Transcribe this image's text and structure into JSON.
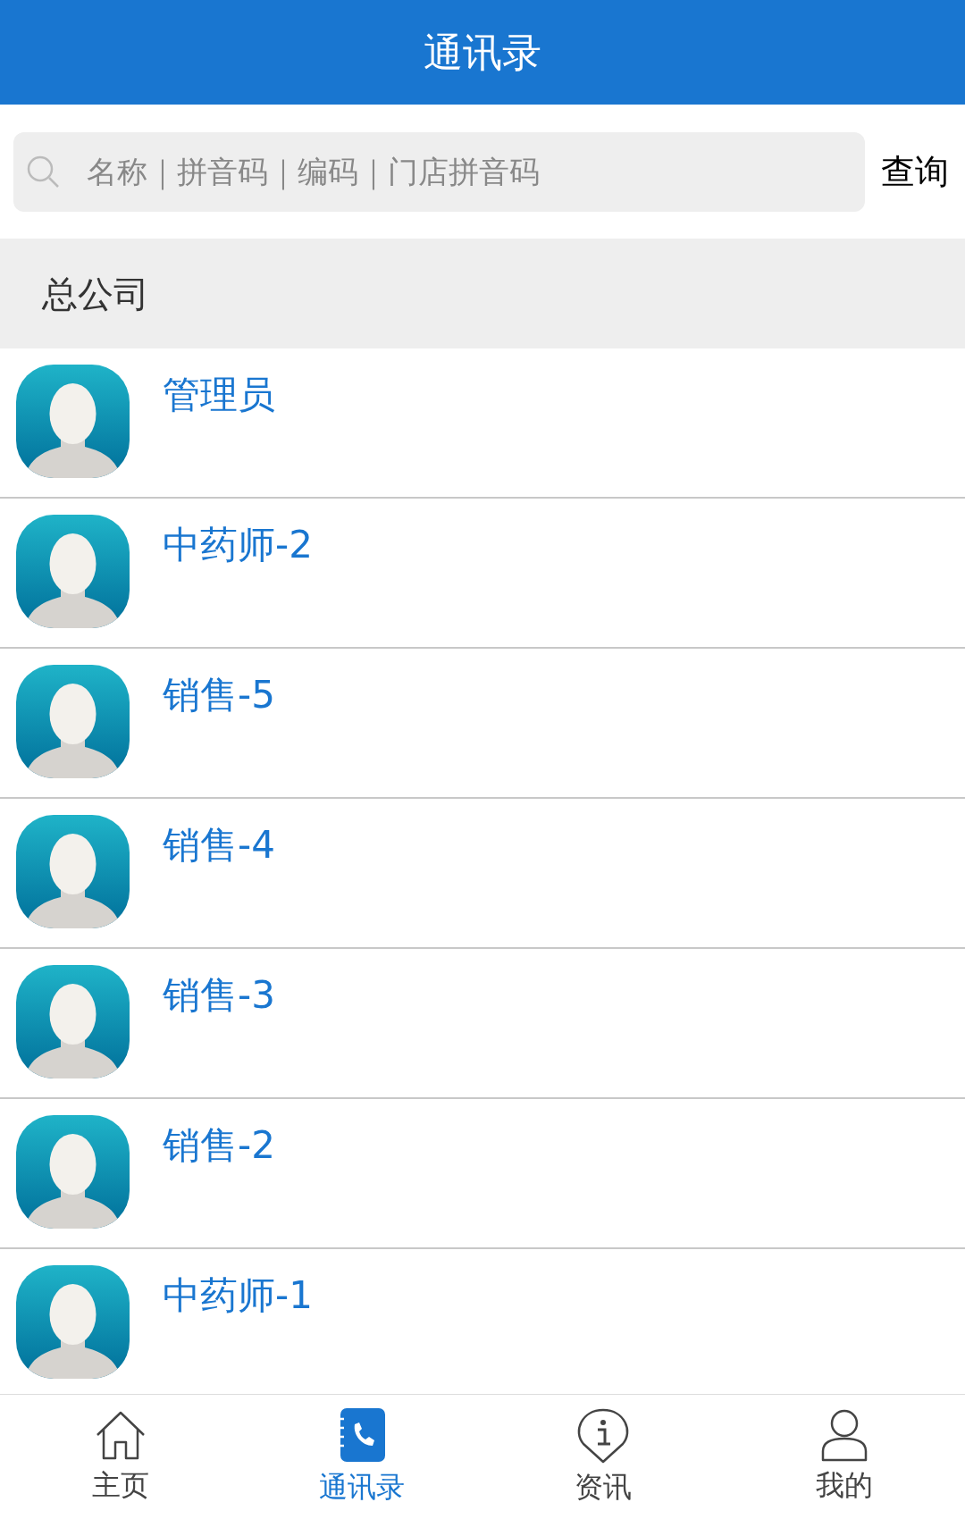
{
  "header": {
    "title": "通讯录"
  },
  "search": {
    "placeholder": "名称｜拼音码｜编码｜门店拼音码",
    "button": "查询"
  },
  "group": {
    "label": "总公司"
  },
  "contacts": [
    {
      "name": "管理员"
    },
    {
      "name": "中药师-2"
    },
    {
      "name": "销售-5"
    },
    {
      "name": "销售-4"
    },
    {
      "name": "销售-3"
    },
    {
      "name": "销售-2"
    },
    {
      "name": "中药师-1"
    }
  ],
  "tab_bar": [
    {
      "kind": "home",
      "label": "主页",
      "selected": false
    },
    {
      "kind": "contacts",
      "label": "通讯录",
      "selected": true
    },
    {
      "kind": "info",
      "label": "资讯",
      "selected": false
    },
    {
      "kind": "profile",
      "label": "我的",
      "selected": false
    }
  ]
}
